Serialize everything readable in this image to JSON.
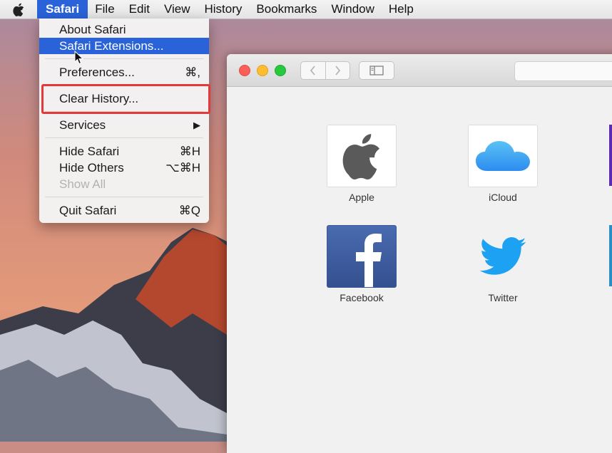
{
  "menubar": {
    "items": [
      "Safari",
      "File",
      "Edit",
      "View",
      "History",
      "Bookmarks",
      "Window",
      "Help"
    ]
  },
  "safari_menu": {
    "items": [
      {
        "label": "About Safari",
        "shortcut": ""
      },
      {
        "label": "Safari Extensions...",
        "shortcut": ""
      },
      {
        "label": "Preferences...",
        "shortcut": "⌘,"
      },
      {
        "label": "Clear History...",
        "shortcut": ""
      },
      {
        "label": "Services",
        "shortcut": "▶"
      },
      {
        "label": "Hide Safari",
        "shortcut": "⌘H"
      },
      {
        "label": "Hide Others",
        "shortcut": "⌥⌘H"
      },
      {
        "label": "Show All",
        "shortcut": ""
      },
      {
        "label": "Quit Safari",
        "shortcut": "⌘Q"
      }
    ],
    "highlighted_item": "Safari Extensions...",
    "annotated_item": "Clear History..."
  },
  "favorites": [
    {
      "label": "Apple",
      "icon": "apple-logo-icon"
    },
    {
      "label": "iCloud",
      "icon": "icloud-icon"
    },
    {
      "label": "Facebook",
      "icon": "facebook-icon"
    },
    {
      "label": "Twitter",
      "icon": "twitter-bird-icon"
    }
  ],
  "colors": {
    "menu_highlight": "#2a62d9",
    "annotation_box": "#e23a3a",
    "facebook_blue": "#3b5998",
    "twitter_blue": "#1da1f2"
  }
}
